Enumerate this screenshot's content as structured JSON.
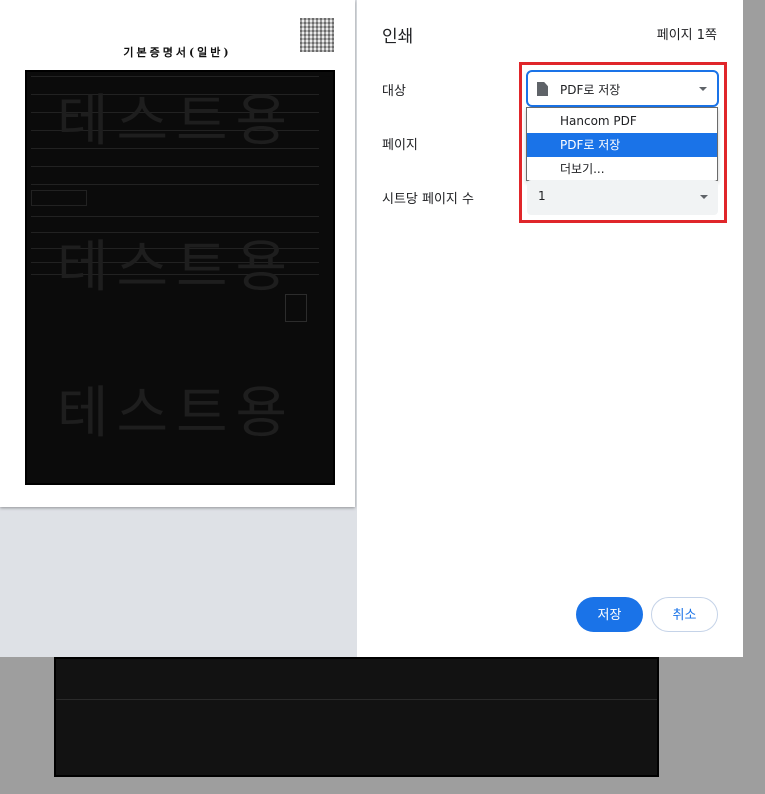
{
  "print_dialog": {
    "title": "인쇄",
    "page_count": "페이지 1쪽",
    "destination": {
      "label": "대상",
      "selected": "PDF로 저장",
      "options": [
        "Hancom PDF",
        "PDF로 저장",
        "더보기..."
      ]
    },
    "pages": {
      "label": "페이지"
    },
    "pages_per_sheet": {
      "label": "시트당 페이지 수",
      "value": "1"
    },
    "save_label": "저장",
    "cancel_label": "취소"
  },
  "preview": {
    "doc_title": "기본증명서(일반)",
    "watermark": "테스트용"
  },
  "colors": {
    "accent": "#1a73e8",
    "highlight": "#e0262a",
    "select_bg": "#f1f3f4",
    "preview_bg": "#dee1e6"
  }
}
